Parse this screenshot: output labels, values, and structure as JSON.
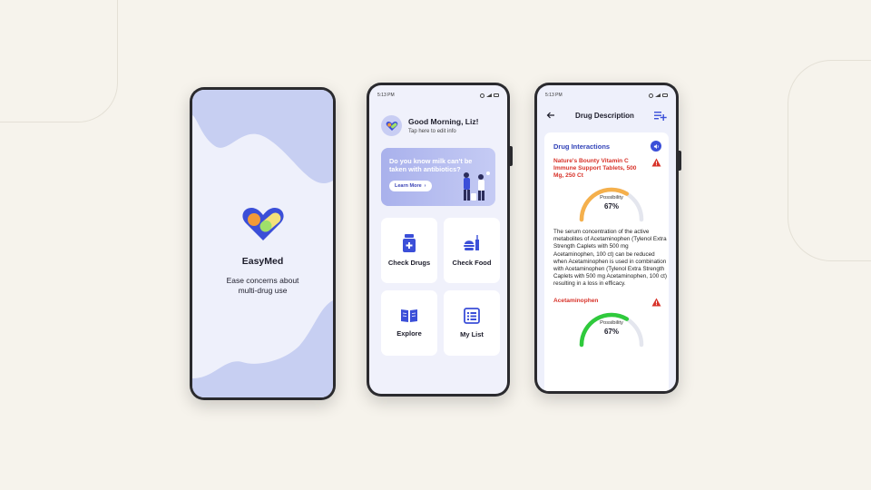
{
  "colors": {
    "background": "#f6f3ec",
    "primary": "#3b4fd8",
    "warning": "#d8332a",
    "gauge_orange": "#f5b04c",
    "gauge_green": "#2fca3c",
    "blob": "#c7cff2"
  },
  "splash": {
    "app_name": "EasyMed",
    "tagline_line1": "Ease concerns about",
    "tagline_line2": "multi-drug use",
    "logo_icon": "heart-pill-icon"
  },
  "home": {
    "status_time": "5:13 PM",
    "greeting": "Good Morning, Liz!",
    "edit_hint": "Tap here to edit info",
    "banner_text": "Do you know milk can't be taken with antibiotics?",
    "learn_more": "Learn More",
    "tiles": [
      {
        "label": "Check Drugs",
        "icon": "medicine-bottle-icon"
      },
      {
        "label": "Check Food",
        "icon": "food-icon"
      },
      {
        "label": "Explore",
        "icon": "book-icon"
      },
      {
        "label": "My List",
        "icon": "list-icon"
      }
    ]
  },
  "detail": {
    "status_time": "5:13 PM",
    "title": "Drug Description",
    "section_title": "Drug Interactions",
    "interactions": [
      {
        "name": "Nature's Bounty Vitamin C Immune Support Tablets, 500 Mg, 250 Ct",
        "possibility_label": "Possibility",
        "possibility": "67%",
        "possibility_fraction": 0.67,
        "gauge_color": "#f5b04c",
        "description": "The serum concentration of the active metabolites of Acetaminophen (Tylenol Extra Strength Caplets with 500 mg Acetaminophen, 100 ct) can be reduced when Acetaminophen is used in combination with Acetaminophen (Tylenol Extra Strength Caplets with 500 mg Acetaminophen, 100 ct) resulting in a loss in efficacy."
      },
      {
        "name": "Acetaminophen",
        "possibility_label": "Possibility",
        "possibility": "67%",
        "possibility_fraction": 0.67,
        "gauge_color": "#2fca3c"
      }
    ]
  }
}
